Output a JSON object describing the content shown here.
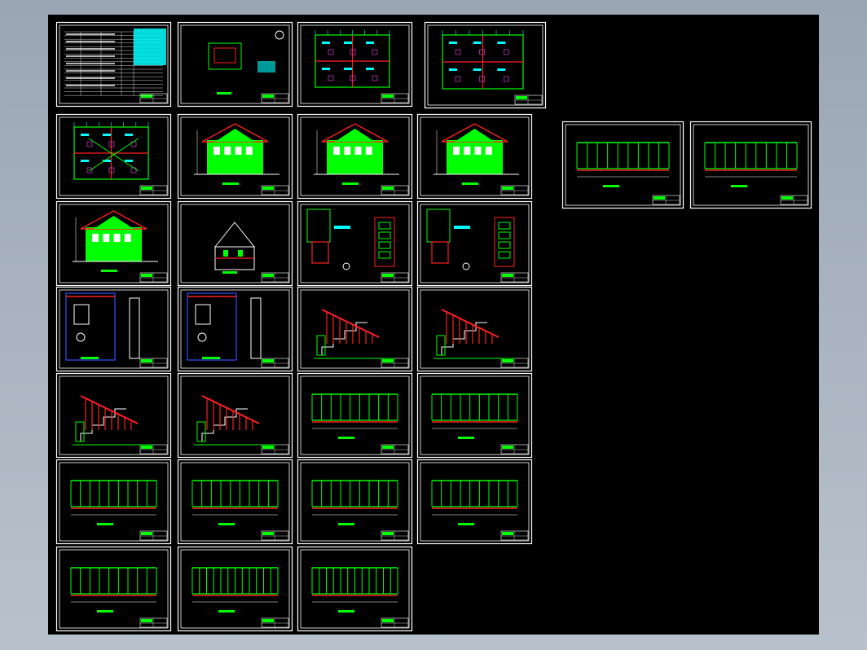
{
  "viewport": {
    "name": "cad-model-space",
    "background": "#000000",
    "frame_color": "#ffffff",
    "colors": {
      "green": "#00ff00",
      "red": "#ff2020",
      "cyan": "#00ffff",
      "blue": "#3050ff",
      "white": "#ffffff",
      "magenta": "#ff40ff",
      "yellow": "#ffff00"
    }
  },
  "sheets": [
    {
      "id": "s01",
      "kind": "index-table"
    },
    {
      "id": "s02",
      "kind": "site-plan"
    },
    {
      "id": "s03",
      "kind": "floor-plan"
    },
    {
      "id": "s04",
      "kind": "floor-plan"
    },
    {
      "id": "s05",
      "kind": "roof-plan"
    },
    {
      "id": "s06",
      "kind": "elevation"
    },
    {
      "id": "s07",
      "kind": "elevation"
    },
    {
      "id": "s08",
      "kind": "elevation-side"
    },
    {
      "id": "s09",
      "kind": "elevation-long"
    },
    {
      "id": "s10",
      "kind": "section"
    },
    {
      "id": "s11",
      "kind": "details"
    },
    {
      "id": "s12",
      "kind": "details"
    },
    {
      "id": "s13",
      "kind": "bath-plan"
    },
    {
      "id": "s14",
      "kind": "bath-plan"
    },
    {
      "id": "s15",
      "kind": "stair"
    },
    {
      "id": "s16",
      "kind": "stair"
    },
    {
      "id": "s17",
      "kind": "stair"
    },
    {
      "id": "s18",
      "kind": "stair"
    },
    {
      "id": "s19",
      "kind": "railing"
    },
    {
      "id": "s20",
      "kind": "railing"
    },
    {
      "id": "s21",
      "kind": "railing"
    },
    {
      "id": "s22",
      "kind": "railing"
    },
    {
      "id": "s23",
      "kind": "railing"
    },
    {
      "id": "s24",
      "kind": "railing"
    },
    {
      "id": "s25",
      "kind": "railing"
    },
    {
      "id": "s26",
      "kind": "railing-wide"
    },
    {
      "id": "s27",
      "kind": "railing-wide"
    },
    {
      "id": "s28",
      "kind": "railing-section"
    },
    {
      "id": "s29",
      "kind": "railing-end"
    },
    {
      "id": "s30",
      "kind": "floor-plan"
    },
    {
      "id": "s31",
      "kind": "floor-plan"
    }
  ]
}
